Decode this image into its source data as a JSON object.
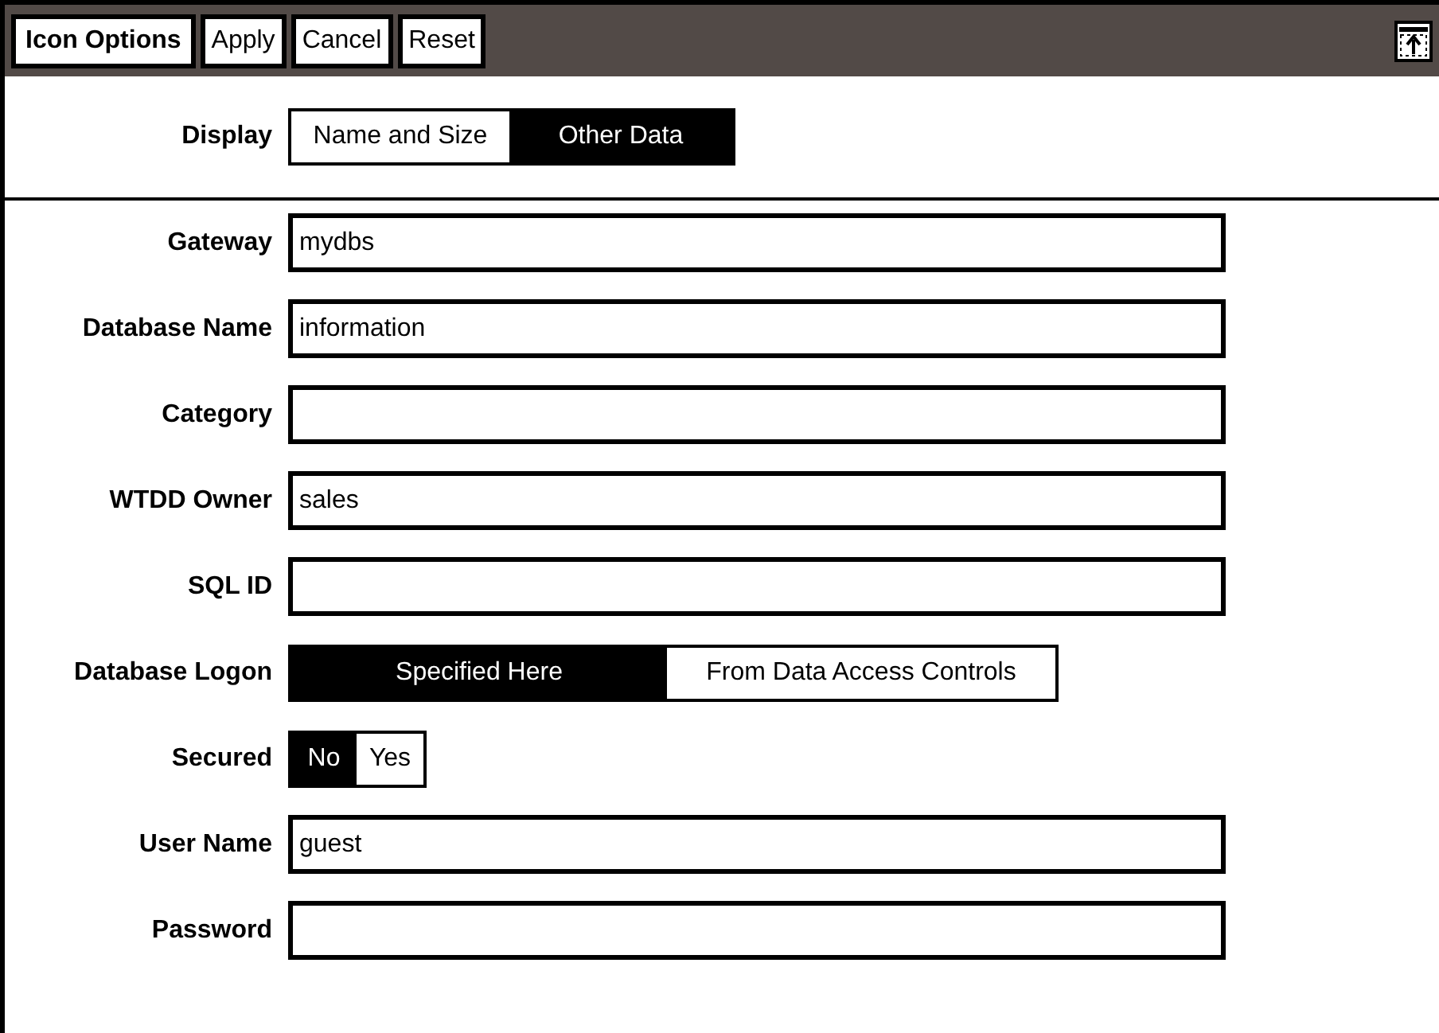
{
  "toolbar": {
    "title": "Icon Options",
    "buttons": [
      "Apply",
      "Cancel",
      "Reset"
    ]
  },
  "display": {
    "label": "Display",
    "options": [
      {
        "label": "Name and Size",
        "selected": false
      },
      {
        "label": "Other Data",
        "selected": true
      }
    ]
  },
  "fields": [
    {
      "kind": "text",
      "label": "Gateway",
      "value": "mydbs"
    },
    {
      "kind": "text",
      "label": "Database Name",
      "value": "information"
    },
    {
      "kind": "text",
      "label": "Category"
    },
    {
      "kind": "text",
      "label": "WTDD Owner",
      "value": "sales"
    },
    {
      "kind": "text",
      "label": "SQL ID"
    },
    {
      "kind": "choice",
      "label": "Database Logon",
      "options": [
        {
          "label": "Specified Here",
          "selected": true
        },
        {
          "label": "From Data Access Controls",
          "selected": false
        }
      ]
    },
    {
      "kind": "choice",
      "label": "Secured",
      "options": [
        {
          "label": "No",
          "selected": true
        },
        {
          "label": "Yes",
          "selected": false
        }
      ]
    },
    {
      "kind": "text",
      "label": "User Name",
      "value": "guest"
    },
    {
      "kind": "text",
      "label": "Password"
    }
  ]
}
